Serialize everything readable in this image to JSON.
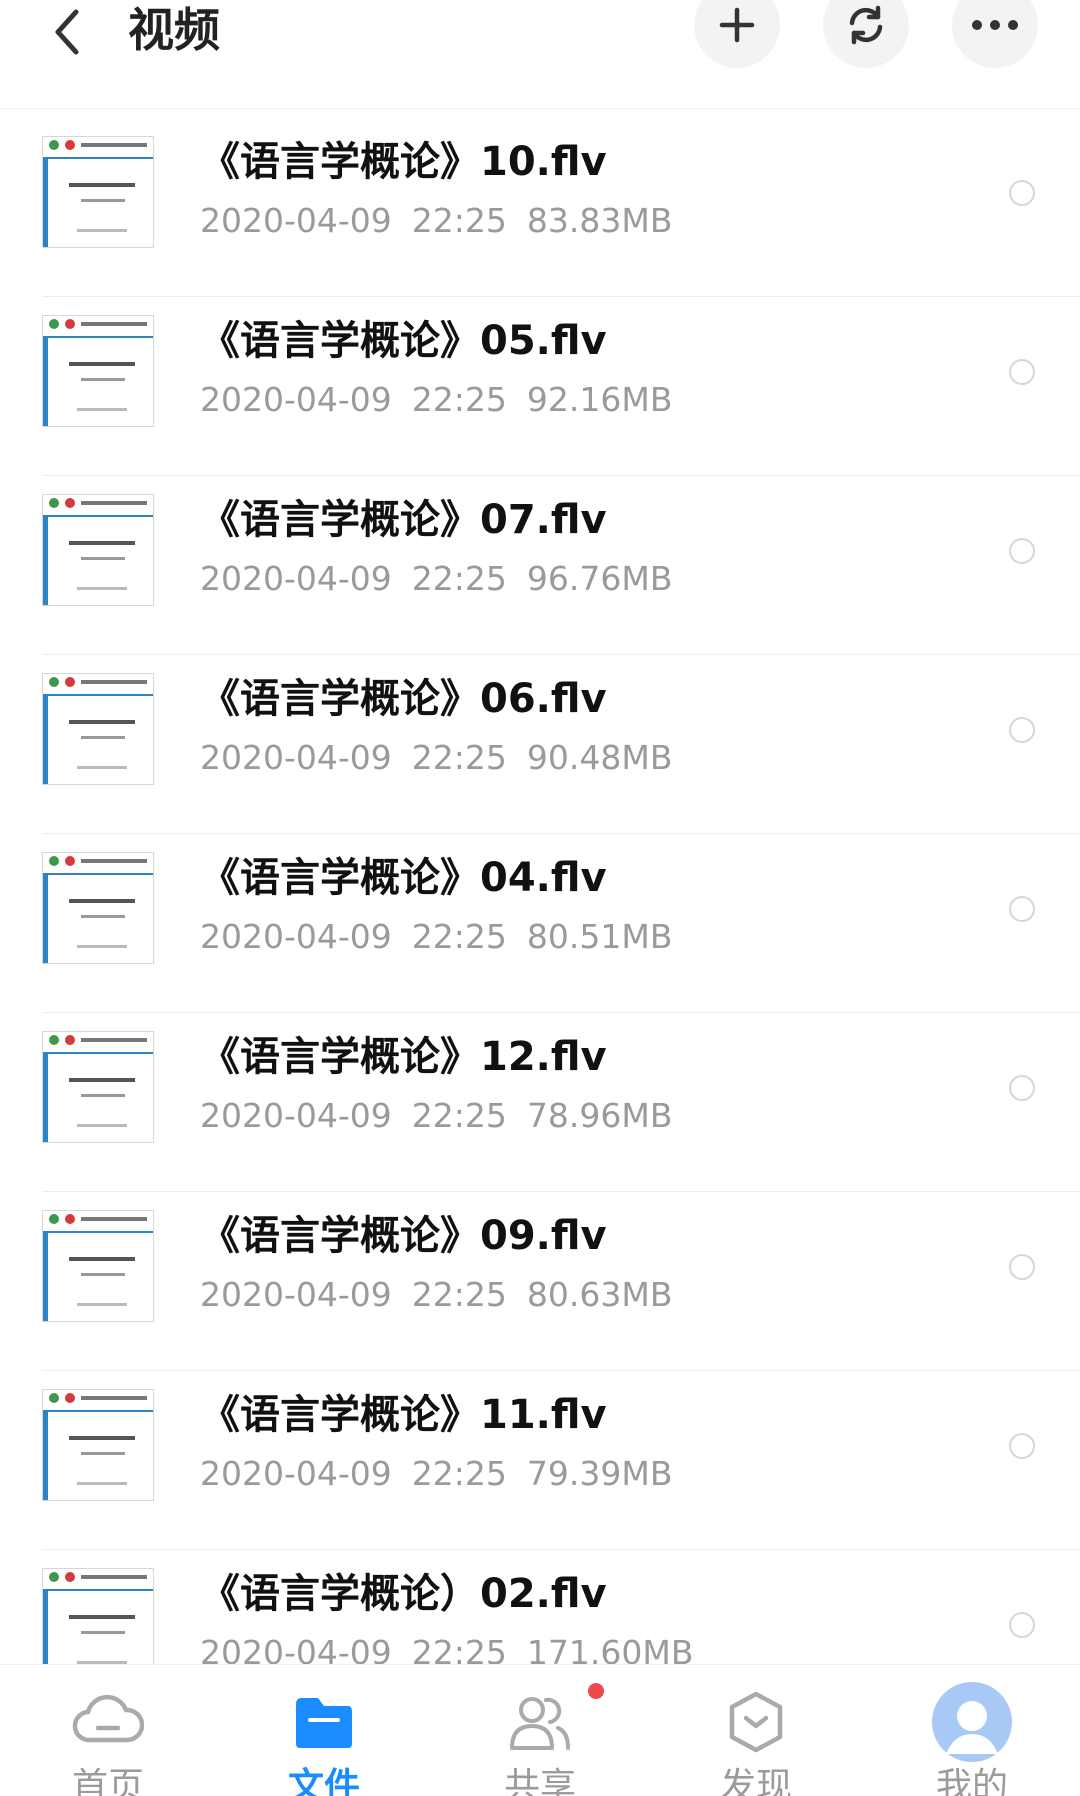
{
  "header": {
    "title": "视频",
    "back_icon": "chevron-left-icon",
    "actions": [
      {
        "name": "add",
        "icon": "plus-icon"
      },
      {
        "name": "refresh",
        "icon": "refresh-icon"
      },
      {
        "name": "more",
        "icon": "more-horizontal-icon"
      }
    ]
  },
  "files": [
    {
      "name": "《语言学概论》10.flv",
      "date": "2020-04-09",
      "time": "22:25",
      "size": "83.83MB"
    },
    {
      "name": "《语言学概论》05.flv",
      "date": "2020-04-09",
      "time": "22:25",
      "size": "92.16MB"
    },
    {
      "name": "《语言学概论》07.flv",
      "date": "2020-04-09",
      "time": "22:25",
      "size": "96.76MB"
    },
    {
      "name": "《语言学概论》06.flv",
      "date": "2020-04-09",
      "time": "22:25",
      "size": "90.48MB"
    },
    {
      "name": "《语言学概论》04.flv",
      "date": "2020-04-09",
      "time": "22:25",
      "size": "80.51MB"
    },
    {
      "name": "《语言学概论》12.flv",
      "date": "2020-04-09",
      "time": "22:25",
      "size": "78.96MB"
    },
    {
      "name": "《语言学概论》09.flv",
      "date": "2020-04-09",
      "time": "22:25",
      "size": "80.63MB"
    },
    {
      "name": "《语言学概论》11.flv",
      "date": "2020-04-09",
      "time": "22:25",
      "size": "79.39MB"
    },
    {
      "name": "《语言学概论）02.flv",
      "date": "2020-04-09",
      "time": "22:25",
      "size": "171.60MB"
    }
  ],
  "nav": {
    "items": [
      {
        "label": "首页",
        "icon": "cloud-icon",
        "active": false
      },
      {
        "label": "文件",
        "icon": "folder-icon",
        "active": true
      },
      {
        "label": "共享",
        "icon": "users-icon",
        "active": false,
        "badge": true
      },
      {
        "label": "发现",
        "icon": "discover-icon",
        "active": false
      },
      {
        "label": "我的",
        "icon": "avatar-icon",
        "active": false
      }
    ]
  },
  "colors": {
    "accent": "#1a8cff",
    "badge": "#f0474a",
    "meta_text": "#9a9a9a"
  }
}
